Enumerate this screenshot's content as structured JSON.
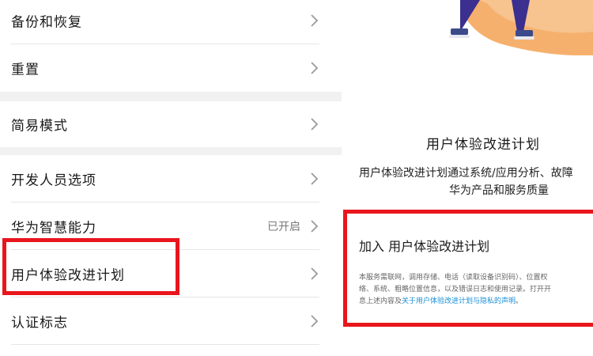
{
  "settings": {
    "rows": [
      {
        "label": "备份和恢复",
        "status": ""
      },
      {
        "label": "重置",
        "status": ""
      },
      {
        "label": "简易模式",
        "status": ""
      },
      {
        "label": "开发人员选项",
        "status": ""
      },
      {
        "label": "华为智慧能力",
        "status": "已开启"
      },
      {
        "label": "用户体验改进计划",
        "status": ""
      },
      {
        "label": "认证标志",
        "status": ""
      }
    ]
  },
  "plan": {
    "title": "用户体验改进计划",
    "desc_line1": "用户体验改进计划通过系统/应用分析、故障",
    "desc_line2": "华为产品和服务质量",
    "join_label": "加入 用户体验改进计划",
    "fine_line1": "本服务需联网，调用存储、电话（读取设备识别码）、位置权",
    "fine_line2": "络、系统、粗略位置信息，以及错误日志和使用记录。打开开",
    "fine_line3_prefix": "息上述内容及",
    "fine_line3_link": "关于用户体验改进计划与隐私的声明",
    "fine_line3_suffix": "。"
  },
  "colors": {
    "highlight_red": "#e8161c",
    "link_blue": "#1a8fd6",
    "illustration_orange": "#f5a25a",
    "figure_purple": "#3b2f8f"
  }
}
